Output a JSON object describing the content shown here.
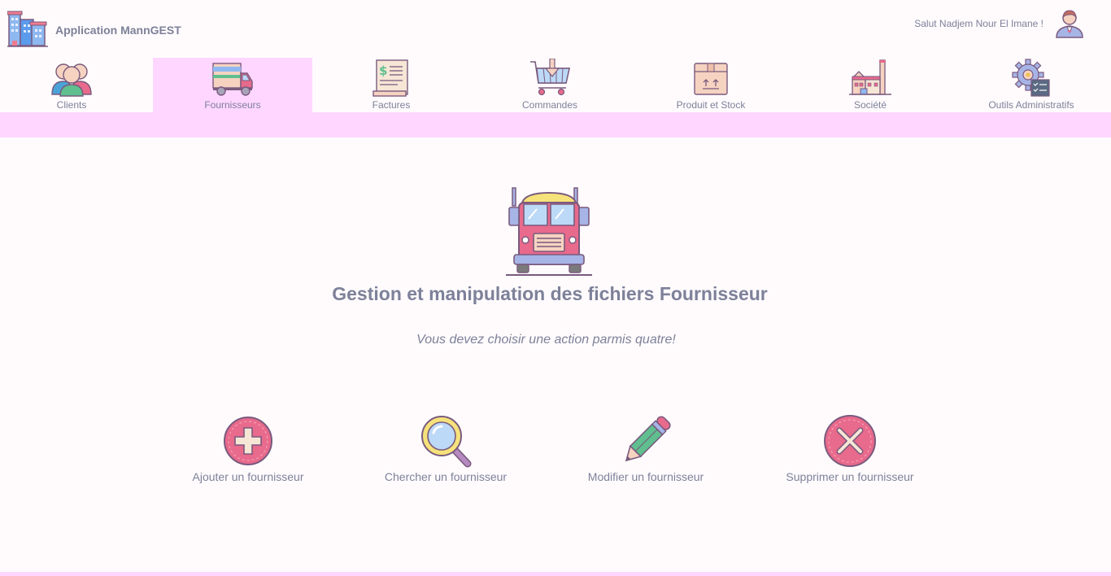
{
  "header": {
    "app_title": "Application MannGEST",
    "greeting": "Salut Nadjem Nour El Imane !",
    "logo_icon": "buildings-icon",
    "avatar_icon": "user-avatar-icon"
  },
  "nav": {
    "active": "Fournisseurs",
    "items": [
      {
        "label": "Clients",
        "icon": "users-icon"
      },
      {
        "label": "Fournisseurs",
        "icon": "delivery-truck-icon"
      },
      {
        "label": "Factures",
        "icon": "invoice-icon"
      },
      {
        "label": "Commandes",
        "icon": "shopping-basket-icon"
      },
      {
        "label": "Produit et Stock",
        "icon": "package-box-icon"
      },
      {
        "label": "Société",
        "icon": "factory-icon"
      },
      {
        "label": "Outils Administratifs",
        "icon": "gear-checklist-icon"
      }
    ]
  },
  "main": {
    "hero_icon": "truck-front-icon",
    "heading": "Gestion et manipulation des fichiers Fournisseur",
    "subtitle": "Vous devez choisir une action parmis quatre!",
    "actions": [
      {
        "label": "Ajouter un fournisseur",
        "icon": "add-circle-icon"
      },
      {
        "label": "Chercher un fournisseur",
        "icon": "magnifier-icon"
      },
      {
        "label": "Modifier un fournisseur",
        "icon": "pencil-icon"
      },
      {
        "label": "Supprimer un fournisseur",
        "icon": "close-circle-icon"
      }
    ]
  },
  "colors": {
    "accent_pink": "#ffd6ff",
    "text": "#7d8199",
    "icon_red": "#e86a8c",
    "icon_outline": "#7a5a7e"
  }
}
